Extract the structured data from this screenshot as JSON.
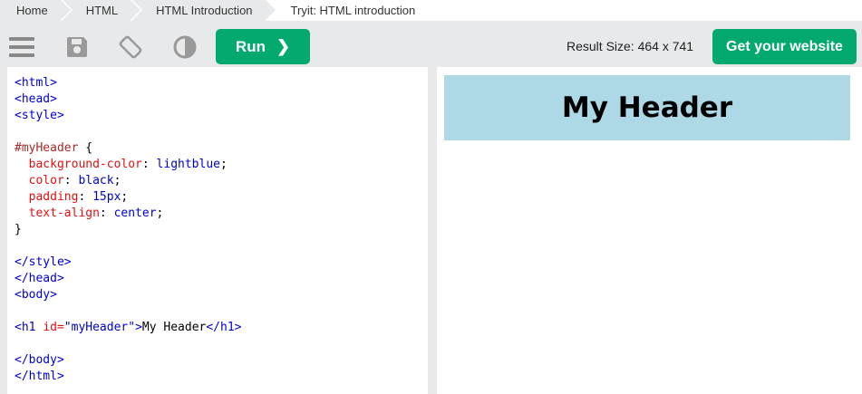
{
  "breadcrumb": [
    "Home",
    "HTML",
    "HTML Introduction",
    "Tryit: HTML introduction"
  ],
  "toolbar": {
    "menu_icon": "hamburger-icon",
    "save_icon": "save-icon",
    "rotate_icon": "rotate-icon",
    "theme_icon": "contrast-icon",
    "run_label": "Run",
    "run_chevron": "❯",
    "result_size": "Result Size: 464 x 741",
    "get_website_label": "Get your website"
  },
  "code_lines": [
    [
      {
        "t": "<html>",
        "c": "tag"
      }
    ],
    [
      {
        "t": "<head>",
        "c": "tag"
      }
    ],
    [
      {
        "t": "<style>",
        "c": "tag"
      }
    ],
    [],
    [
      {
        "t": "#myHeader",
        "c": "sel"
      },
      {
        "t": " {",
        "c": "txt"
      }
    ],
    [
      {
        "t": "  background-color",
        "c": "prop"
      },
      {
        "t": ": ",
        "c": "txt"
      },
      {
        "t": "lightblue",
        "c": "val"
      },
      {
        "t": ";",
        "c": "txt"
      }
    ],
    [
      {
        "t": "  color",
        "c": "prop"
      },
      {
        "t": ": ",
        "c": "txt"
      },
      {
        "t": "black",
        "c": "val"
      },
      {
        "t": ";",
        "c": "txt"
      }
    ],
    [
      {
        "t": "  padding",
        "c": "prop"
      },
      {
        "t": ": ",
        "c": "txt"
      },
      {
        "t": "15px",
        "c": "val"
      },
      {
        "t": ";",
        "c": "txt"
      }
    ],
    [
      {
        "t": "  text-align",
        "c": "prop"
      },
      {
        "t": ": ",
        "c": "txt"
      },
      {
        "t": "center",
        "c": "val"
      },
      {
        "t": ";",
        "c": "txt"
      }
    ],
    [
      {
        "t": "}",
        "c": "txt"
      }
    ],
    [],
    [
      {
        "t": "</style>",
        "c": "tag"
      }
    ],
    [
      {
        "t": "</head>",
        "c": "tag"
      }
    ],
    [
      {
        "t": "<body>",
        "c": "tag"
      }
    ],
    [],
    [
      {
        "t": "<h1 ",
        "c": "tag"
      },
      {
        "t": "id=",
        "c": "attr"
      },
      {
        "t": "\"myHeader\"",
        "c": "val"
      },
      {
        "t": ">",
        "c": "tag"
      },
      {
        "t": "My Header",
        "c": "txt"
      },
      {
        "t": "</h1>",
        "c": "tag"
      }
    ],
    [],
    [
      {
        "t": "</body>",
        "c": "tag"
      }
    ],
    [
      {
        "t": "</html>",
        "c": "tag"
      }
    ]
  ],
  "result": {
    "header_text": "My Header"
  },
  "colors": {
    "accent": "#04aa6d",
    "toolbar_bg": "#e7e9eb",
    "header_bg": "#add8e6"
  }
}
